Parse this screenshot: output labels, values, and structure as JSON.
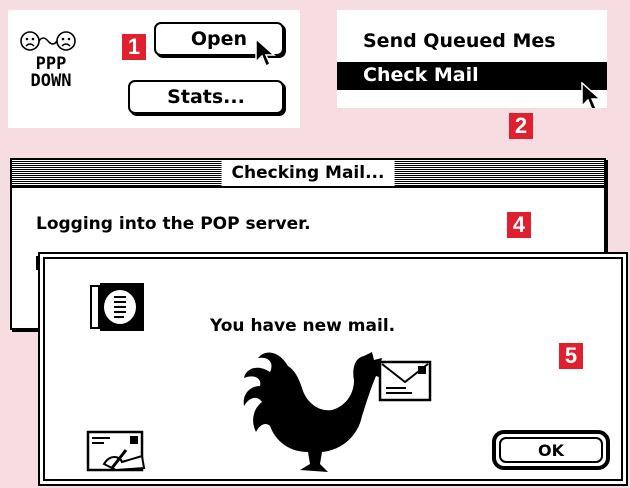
{
  "ppp_panel": {
    "status_line1": "PPP",
    "status_line2": "DOWN",
    "open_label": "Open",
    "stats_label": "Stats...",
    "badge": "1"
  },
  "mail_menu": {
    "items": [
      "Send Queued Mes",
      "Check Mail"
    ],
    "badge": "2"
  },
  "checking_window": {
    "title": "Checking Mail...",
    "message": "Logging into the POP server.",
    "badge": "4"
  },
  "alert": {
    "message": "You have new mail.",
    "ok_label": "OK",
    "badge": "5"
  },
  "colors": {
    "background": "#f7dde2",
    "badge": "#e0202e"
  }
}
